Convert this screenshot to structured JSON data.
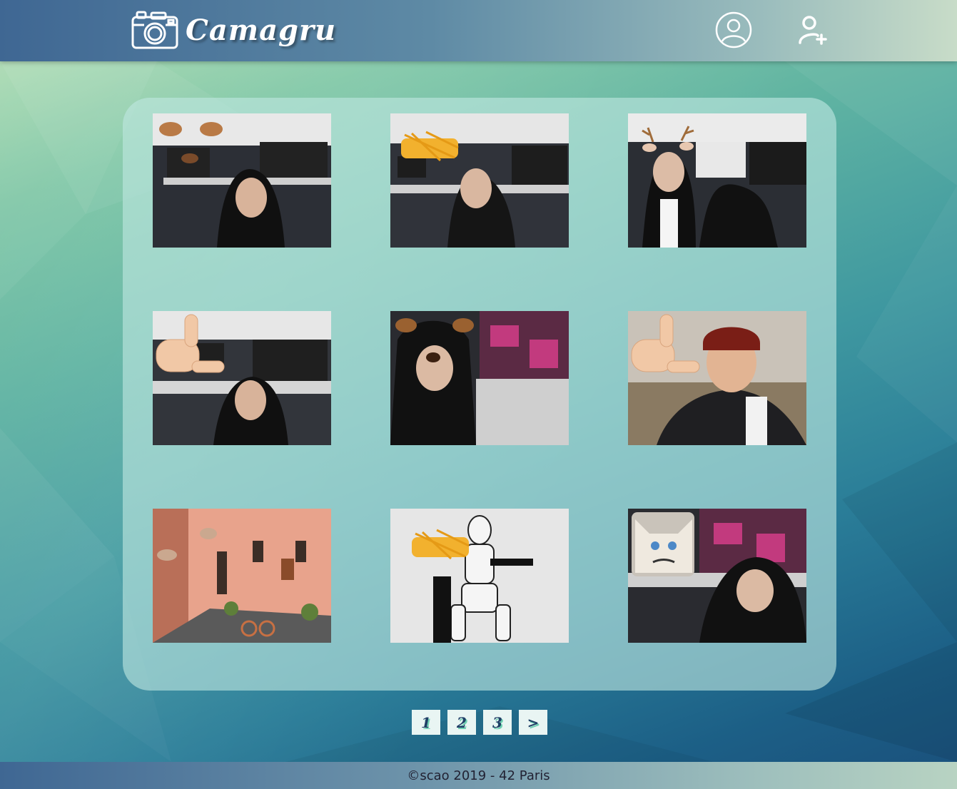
{
  "app": {
    "title": "Camagru"
  },
  "header": {
    "logo_text": "Camagru",
    "logo_icon": "camera-icon",
    "login_icon": "user-circle-icon",
    "signup_icon": "user-plus-icon"
  },
  "gallery": {
    "photos": [
      {
        "name": "photo-1",
        "overlay": "dog-ears-nose"
      },
      {
        "name": "photo-2",
        "overlay": "french-fries"
      },
      {
        "name": "photo-3",
        "overlay": "deer-antlers"
      },
      {
        "name": "photo-4",
        "overlay": "call-me-hand"
      },
      {
        "name": "photo-5",
        "overlay": "dog-ears-nose"
      },
      {
        "name": "photo-6",
        "overlay": "call-me-hand"
      },
      {
        "name": "photo-7",
        "overlay": "ears"
      },
      {
        "name": "photo-8",
        "overlay": "french-fries"
      },
      {
        "name": "photo-9",
        "overlay": "grumpy-cat"
      }
    ]
  },
  "pagination": {
    "pages": [
      "1",
      "2",
      "3"
    ],
    "next_label": ">"
  },
  "footer": {
    "text": "©scao 2019 - 42 Paris"
  },
  "colors": {
    "header_start": "#3f6793",
    "header_end": "#c8dcc8",
    "panel": "#bee6e1",
    "page_button": "#e9f5f3"
  }
}
